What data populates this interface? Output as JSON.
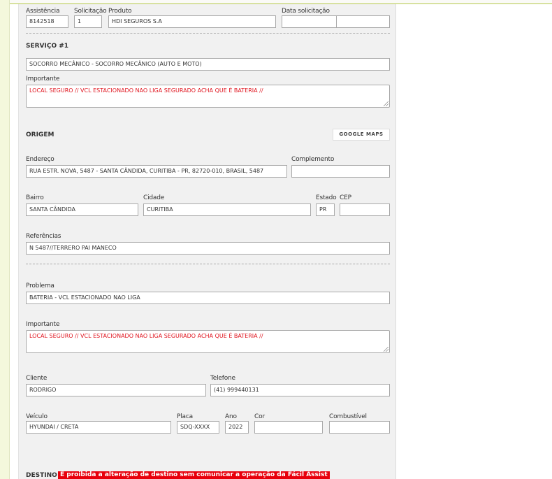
{
  "header": {
    "assistencia_label": "Assistência",
    "assistencia": "8142518",
    "solicitacao_label": "Solicitação",
    "solicitacao": "1",
    "produto_label": "Produto",
    "produto": "HDI SEGUROS S.A",
    "data_label": "Data solicitação",
    "data_date": "",
    "data_time": ""
  },
  "servico": {
    "title": "SERVIÇO #1",
    "servico": "SOCORRO MECÂNICO - SOCORRO MECÂNICO (AUTO E MOTO)",
    "importante_label": "Importante",
    "importante": "LOCAL SEGURO // VCL ESTACIONADO NAO LIGA SEGURADO ACHA QUE É BATERIA //"
  },
  "origem": {
    "title": "ORIGEM",
    "maps_button": "GOOGLE MAPS",
    "endereco_label": "Endereço",
    "endereco": "RUA ESTR. NOVA, 5487 - SANTA CÂNDIDA, CURITIBA - PR, 82720-010, BRASIL, 5487",
    "complemento_label": "Complemento",
    "complemento": "",
    "bairro_label": "Bairro",
    "bairro": "SANTA CÂNDIDA",
    "cidade_label": "Cidade",
    "cidade": "CURITIBA",
    "estado_label": "Estado",
    "estado": "PR",
    "cep_label": "CEP",
    "cep": "",
    "referencias_label": "Referências",
    "referencias": "N 5487//TERRERO PAI MANECO"
  },
  "problema": {
    "problema_label": "Problema",
    "problema": "BATERIA - VCL ESTACIONADO NAO LIGA",
    "importante_label": "Importante",
    "importante": "LOCAL SEGURO // VCL ESTACIONADO NAO LIGA SEGURADO ACHA QUE É BATERIA //"
  },
  "cliente": {
    "cliente_label": "Cliente",
    "cliente": "RODRIGO",
    "telefone_label": "Telefone",
    "telefone": "(41) 999440131"
  },
  "veiculo": {
    "veiculo_label": "Veículo",
    "veiculo": "HYUNDAI / CRETA",
    "placa_label": "Placa",
    "placa": "SDQ-XXXX",
    "ano_label": "Ano",
    "ano": "2022",
    "cor_label": "Cor",
    "cor": "",
    "combustivel_label": "Combustível",
    "combustivel": ""
  },
  "destino": {
    "title": "DESTINO",
    "warning": "É proibida a alteração de destino sem comunicar a operação da Fácil Assist"
  },
  "colors": {
    "warning": "#e8000c",
    "important_text": "#e0141e",
    "accent_line": "#b5c94a"
  }
}
